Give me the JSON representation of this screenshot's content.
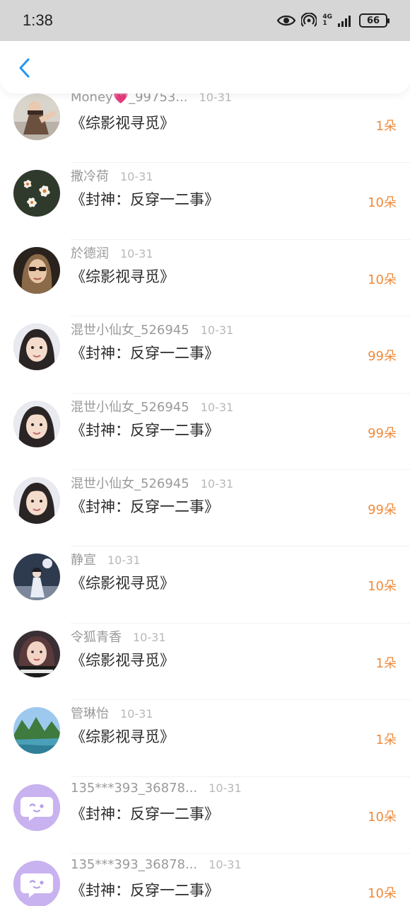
{
  "status": {
    "time": "1:38",
    "network_top": "4G",
    "network_bottom": "1",
    "battery": "66"
  },
  "colors": {
    "accent": "#2196f3",
    "amount": "#f08a3a"
  },
  "rows": [
    {
      "user": "Money💗_99753...",
      "date": "10-31",
      "book": "《综影视寻觅》",
      "amount": "1朵",
      "avatar": "illustration"
    },
    {
      "user": "撒冷荷",
      "date": "10-31",
      "book": "《封神：反穿一二事》",
      "amount": "10朵",
      "avatar": "flowers"
    },
    {
      "user": "於德润",
      "date": "10-31",
      "book": "《综影视寻觅》",
      "amount": "10朵",
      "avatar": "portrait-sunglasses"
    },
    {
      "user": "混世小仙女_526945",
      "date": "10-31",
      "book": "《封神：反穿一二事》",
      "amount": "99朵",
      "avatar": "girl-portrait"
    },
    {
      "user": "混世小仙女_526945",
      "date": "10-31",
      "book": "《封神：反穿一二事》",
      "amount": "99朵",
      "avatar": "girl-portrait"
    },
    {
      "user": "混世小仙女_526945",
      "date": "10-31",
      "book": "《封神：反穿一二事》",
      "amount": "99朵",
      "avatar": "girl-portrait"
    },
    {
      "user": "静宣",
      "date": "10-31",
      "book": "《综影视寻觅》",
      "amount": "10朵",
      "avatar": "night-figure"
    },
    {
      "user": "令狐青香",
      "date": "10-31",
      "book": "《综影视寻觅》",
      "amount": "1朵",
      "avatar": "woman-caption"
    },
    {
      "user": "管琳怡",
      "date": "10-31",
      "book": "《综影视寻觅》",
      "amount": "1朵",
      "avatar": "landscape"
    },
    {
      "user": "135***393_36878...",
      "date": "10-31",
      "book": "《封神：反穿一二事》",
      "amount": "10朵",
      "avatar": "chat-bubble"
    },
    {
      "user": "135***393_36878...",
      "date": "10-31",
      "book": "《封神：反穿一二事》",
      "amount": "10朵",
      "avatar": "chat-bubble"
    }
  ]
}
